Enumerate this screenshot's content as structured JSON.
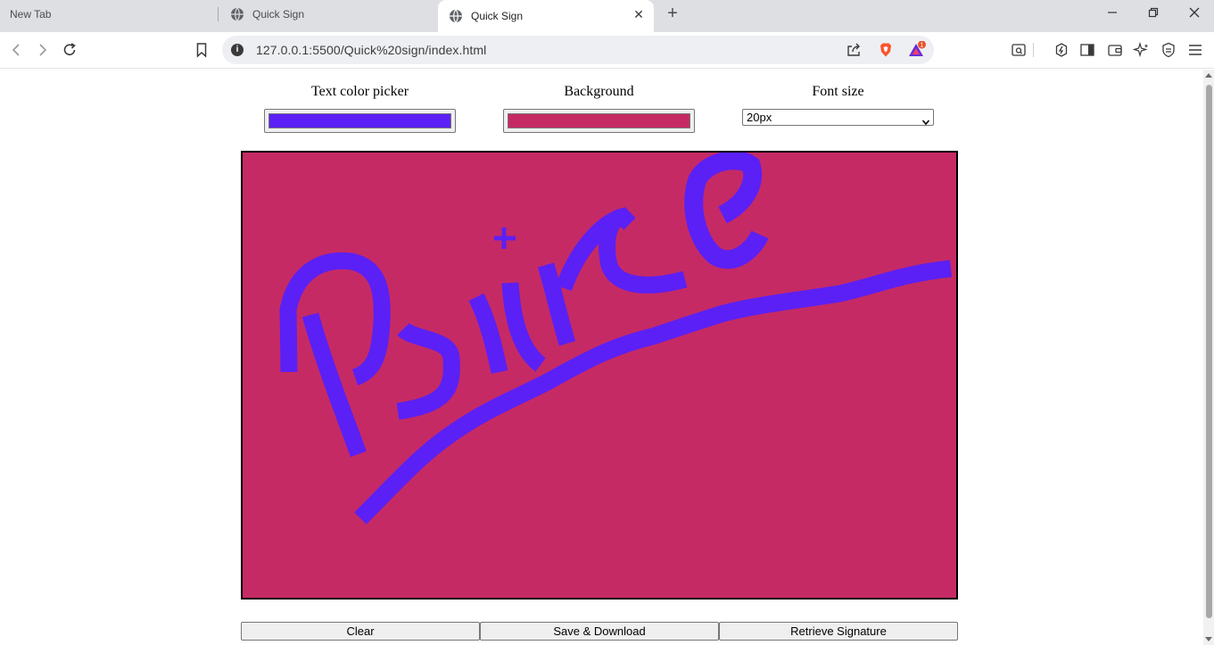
{
  "browser": {
    "tabs": [
      {
        "label": "New Tab"
      },
      {
        "label": "Quick Sign"
      },
      {
        "label": "Quick Sign",
        "active": true
      }
    ],
    "url": "127.0.0.1:5500/Quick%20sign/index.html",
    "notification_count": "1"
  },
  "controls": {
    "text_color_label": "Text color picker",
    "text_color_value": "#5b20f5",
    "background_label": "Background",
    "background_value": "#c62a65",
    "font_size_label": "Font size",
    "font_size_value": "20px"
  },
  "canvas": {
    "background": "#c62a65",
    "stroke_color": "#5b20f5",
    "signature_handwriting": "Prince"
  },
  "buttons": {
    "clear": "Clear",
    "save": "Save & Download",
    "retrieve": "Retrieve Signature"
  }
}
